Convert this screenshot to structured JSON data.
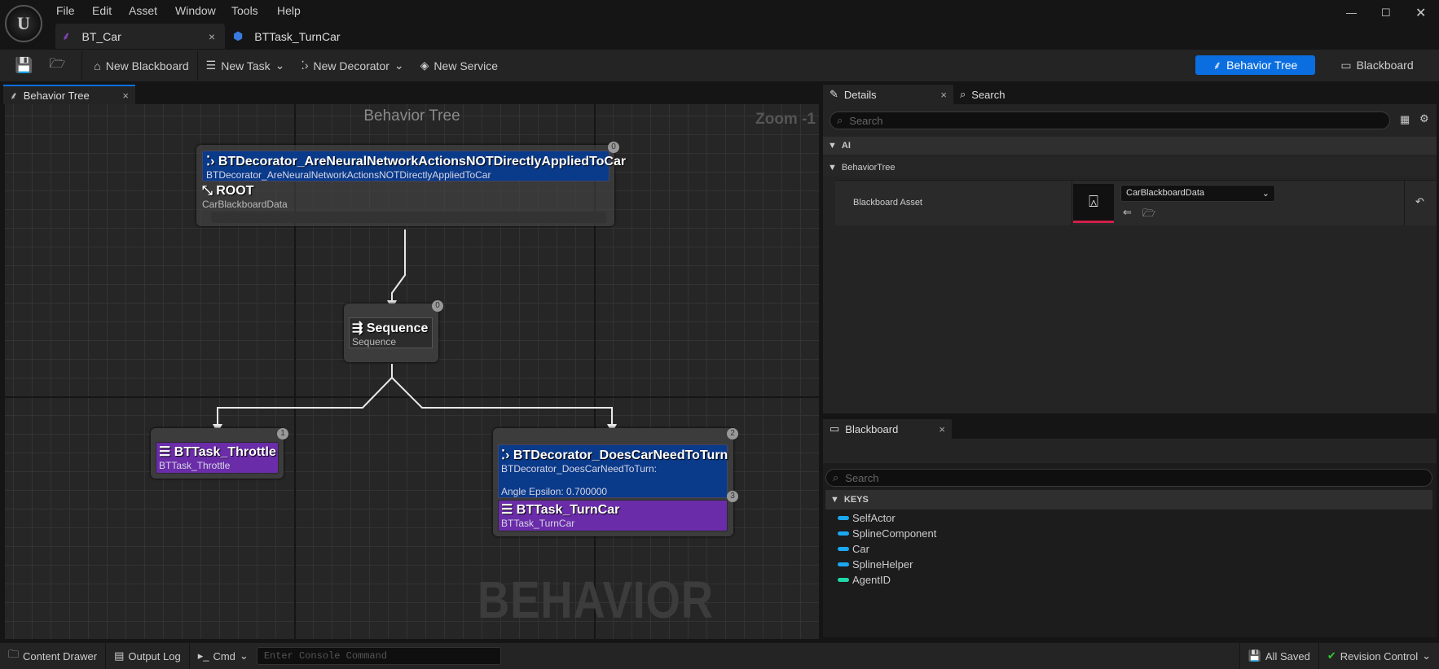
{
  "menu": [
    "File",
    "Edit",
    "Asset",
    "Window",
    "Tools",
    "Help"
  ],
  "doc_tabs": [
    {
      "label": "BT_Car",
      "active": true
    },
    {
      "label": "BTTask_TurnCar",
      "active": false
    }
  ],
  "toolbar": {
    "new_blackboard": "New Blackboard",
    "new_task": "New Task",
    "new_decorator": "New Decorator",
    "new_service": "New Service",
    "mode_behavior_tree": "Behavior Tree",
    "mode_blackboard": "Blackboard",
    "accent": "#0a6ee0"
  },
  "graph": {
    "tab": "Behavior Tree",
    "title": "Behavior Tree",
    "zoom": "Zoom -1",
    "watermark": "BEHAVIOR TREE",
    "root": {
      "decorator_title": "BTDecorator_AreNeuralNetworkActionsNOTDirectlyAppliedToCar",
      "decorator_sub": "BTDecorator_AreNeuralNetworkActionsNOTDirectlyAppliedToCar",
      "title": "ROOT",
      "sub": "CarBlackboardData",
      "index": "0"
    },
    "sequence": {
      "title": "Sequence",
      "sub": "Sequence",
      "index": "0"
    },
    "throttle": {
      "title": "BTTask_Throttle",
      "sub": "BTTask_Throttle",
      "index": "1"
    },
    "turn": {
      "decorator_title": "BTDecorator_DoesCarNeedToTurn",
      "decorator_sub": "BTDecorator_DoesCarNeedToTurn:",
      "decorator_param": "Angle Epsilon: 0.700000",
      "decorator_index": "2",
      "title": "BTTask_TurnCar",
      "sub": "BTTask_TurnCar",
      "index": "3"
    }
  },
  "details": {
    "tab": "Details",
    "search_tab": "Search",
    "search_placeholder": "Search",
    "cat_ai": "AI",
    "cat_bt": "BehaviorTree",
    "prop_label": "Blackboard Asset",
    "prop_value": "CarBlackboardData"
  },
  "blackboard": {
    "tab": "Blackboard",
    "search_placeholder": "Search",
    "keys_header": "KEYS",
    "keys": [
      {
        "name": "SelfActor",
        "color": "#1aa8f0"
      },
      {
        "name": "SplineComponent",
        "color": "#1aa8f0"
      },
      {
        "name": "Car",
        "color": "#1aa8f0"
      },
      {
        "name": "SplineHelper",
        "color": "#1aa8f0"
      },
      {
        "name": "AgentID",
        "color": "#20d8a8"
      }
    ]
  },
  "status": {
    "content_drawer": "Content Drawer",
    "output_log": "Output Log",
    "cmd": "Cmd",
    "console_placeholder": "Enter Console Command",
    "all_saved": "All Saved",
    "revision_control": "Revision Control"
  }
}
